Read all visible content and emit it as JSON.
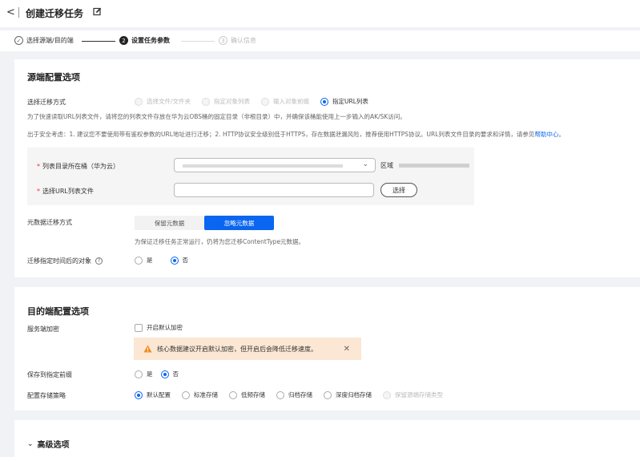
{
  "header": {
    "back_label": "<",
    "title": "创建迁移任务"
  },
  "steps": [
    {
      "num": "✓",
      "label": "选择源端/目的端",
      "state": "done"
    },
    {
      "num": "2",
      "label": "设置任务参数",
      "state": "active"
    },
    {
      "num": "3",
      "label": "确认信息",
      "state": "todo"
    }
  ],
  "source": {
    "title": "源端配置选项",
    "method_label": "选择迁移方式",
    "methods": [
      {
        "label": "选择文件/文件夹",
        "state": "disabled"
      },
      {
        "label": "指定对象列表",
        "state": "disabled"
      },
      {
        "label": "输入对象前缀",
        "state": "disabled"
      },
      {
        "label": "指定URL列表",
        "state": "selected"
      }
    ],
    "note1": "为了快速读取URL列表文件，请将您的列表文件存放在华为云OBS桶的固定目录（非根目录）中，并确保该桶能使用上一步输入的AK/SK访问。",
    "note2": "出于安全考虑：1. 建议您不要使用带有鉴权参数的URL地址进行迁移；2. HTTP协议安全级别低于HTTPS，存在数据泄漏风险，推荐使用HTTPS协议。URL列表文件目录的要求和详情，请参见",
    "note2_link": "帮助中心",
    "note2_tail": "。",
    "bucket_label": "列表目录所在桶（华为云）",
    "region_label": "区域",
    "url_file_label": "选择URL列表文件",
    "select_button": "选择",
    "metadata_label": "元数据迁移方式",
    "metadata_options": [
      "保留元数据",
      "忽略元数据"
    ],
    "metadata_selected": "忽略元数据",
    "metadata_note": "为保证迁移任务正常运行，仍将为您迁移ContentType元数据。",
    "time_label": "迁移指定时间后的对象",
    "time_options": [
      {
        "label": "是",
        "state": "off"
      },
      {
        "label": "否",
        "state": "selected"
      }
    ]
  },
  "dest": {
    "title": "目的端配置选项",
    "encrypt_label": "服务端加密",
    "encrypt_checkbox": "开启默认加密",
    "warning": "核心数据建议开启默认加密，但开启后会降低迁移速度。",
    "prefix_label": "保存到指定前缀",
    "prefix_options": [
      {
        "label": "是",
        "state": "off"
      },
      {
        "label": "否",
        "state": "selected"
      }
    ],
    "storage_label": "配置存储策略",
    "storage_options": [
      {
        "label": "默认配置",
        "state": "selected"
      },
      {
        "label": "标准存储",
        "state": "off"
      },
      {
        "label": "低频存储",
        "state": "off"
      },
      {
        "label": "归档存储",
        "state": "off"
      },
      {
        "label": "深度归档存储",
        "state": "off"
      },
      {
        "label": "保留源端存储类型",
        "state": "disabled"
      }
    ]
  },
  "advanced": {
    "title": "高级选项"
  },
  "colors": {
    "accent": "#0a66f0",
    "warning_bg": "#fbe7d3",
    "warning_icon": "#f08c1e",
    "required": "#ee3333"
  }
}
